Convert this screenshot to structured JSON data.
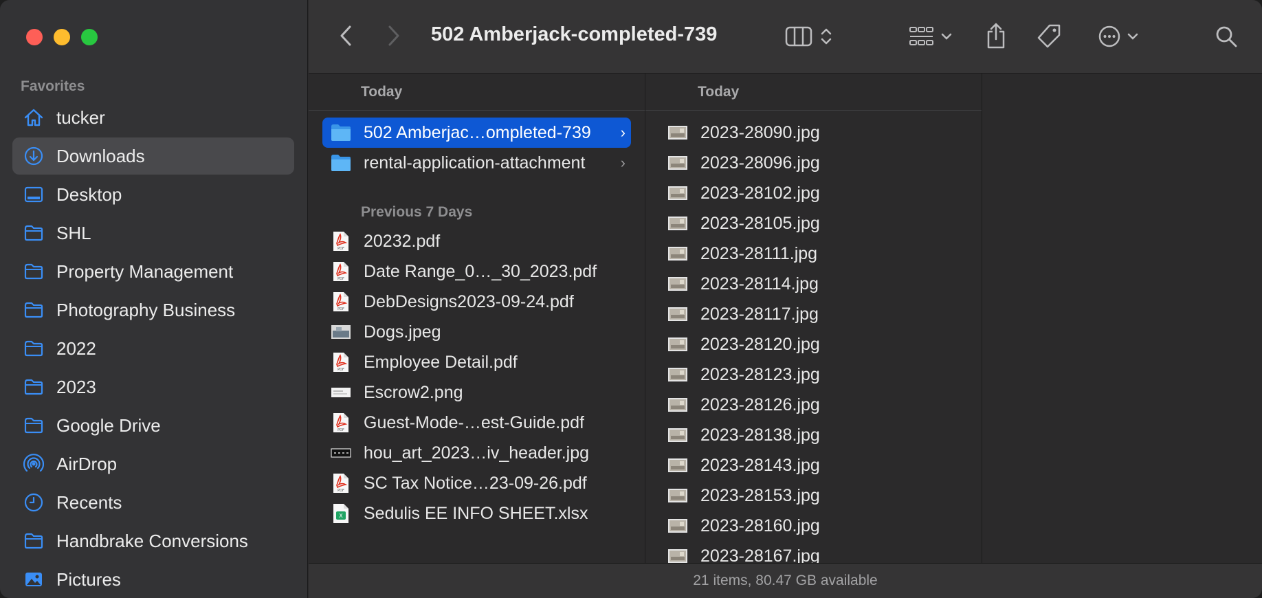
{
  "window": {
    "title": "502 Amberjack-completed-739"
  },
  "sidebar": {
    "heading": "Favorites",
    "items": [
      {
        "label": "tucker",
        "icon": "home-icon"
      },
      {
        "label": "Downloads",
        "icon": "downloads-icon"
      },
      {
        "label": "Desktop",
        "icon": "desktop-icon"
      },
      {
        "label": "SHL",
        "icon": "folder-icon"
      },
      {
        "label": "Property Management",
        "icon": "folder-icon"
      },
      {
        "label": "Photography Business",
        "icon": "folder-icon"
      },
      {
        "label": "2022",
        "icon": "folder-icon"
      },
      {
        "label": "2023",
        "icon": "folder-icon"
      },
      {
        "label": "Google Drive",
        "icon": "folder-icon"
      },
      {
        "label": "AirDrop",
        "icon": "airdrop-icon"
      },
      {
        "label": "Recents",
        "icon": "clock-icon"
      },
      {
        "label": "Handbrake Conversions",
        "icon": "folder-icon"
      },
      {
        "label": "Pictures",
        "icon": "pictures-icon"
      }
    ]
  },
  "column1": {
    "header": "Today",
    "today_items": [
      {
        "name": "502 Amberjac…ompleted-739",
        "type": "folder"
      },
      {
        "name": "rental-application-attachment",
        "type": "folder"
      }
    ],
    "section2_label": "Previous 7 Days",
    "previous_items": [
      {
        "name": "20232.pdf",
        "type": "pdf"
      },
      {
        "name": "Date Range_0…_30_2023.pdf",
        "type": "pdf"
      },
      {
        "name": "DebDesigns2023-09-24.pdf",
        "type": "pdf"
      },
      {
        "name": "Dogs.jpeg",
        "type": "image"
      },
      {
        "name": "Employee Detail.pdf",
        "type": "pdf"
      },
      {
        "name": "Escrow2.png",
        "type": "png"
      },
      {
        "name": "Guest-Mode-…est-Guide.pdf",
        "type": "pdf"
      },
      {
        "name": "hou_art_2023…iv_header.jpg",
        "type": "banner"
      },
      {
        "name": "SC Tax Notice…23-09-26.pdf",
        "type": "pdf"
      },
      {
        "name": "Sedulis EE INFO SHEET.xlsx",
        "type": "xlsx"
      }
    ]
  },
  "column2": {
    "header": "Today",
    "items": [
      "2023-28090.jpg",
      "2023-28096.jpg",
      "2023-28102.jpg",
      "2023-28105.jpg",
      "2023-28111.jpg",
      "2023-28114.jpg",
      "2023-28117.jpg",
      "2023-28120.jpg",
      "2023-28123.jpg",
      "2023-28126.jpg",
      "2023-28138.jpg",
      "2023-28143.jpg",
      "2023-28153.jpg",
      "2023-28160.jpg",
      "2023-28167.jpg"
    ]
  },
  "status": {
    "text": "21 items, 80.47 GB available"
  },
  "colors": {
    "accent": "#0e58d4",
    "sidebar_icon": "#3a8ef6"
  }
}
